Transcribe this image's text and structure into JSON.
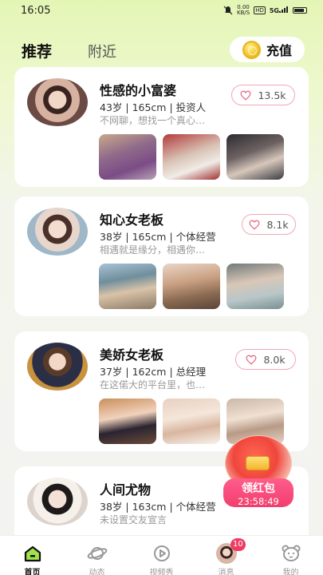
{
  "status_bar": {
    "time": "16:05",
    "network_speed": "0.00\nKB/S",
    "hd": "HD",
    "signal": "5G"
  },
  "top": {
    "tab_recommend": "推荐",
    "tab_nearby": "附近",
    "recharge_label": "充值"
  },
  "colors": {
    "accent_pink": "#f23e6f",
    "like_border": "#f2a7b5",
    "bg_green": "#e4f6b5"
  },
  "profiles": [
    {
      "name": "性感的小富婆",
      "meta": "43岁 | 165cm | 投资人",
      "bio": "不网聊，想找一个真心…",
      "likes": "13.5k"
    },
    {
      "name": "知心女老板",
      "meta": "38岁 | 165cm | 个体经营",
      "bio": "相遇就是缘分，相遇你…",
      "likes": "8.1k"
    },
    {
      "name": "美娇女老板",
      "meta": "37岁 | 162cm | 总经理",
      "bio": "在这偌大的平台里，也…",
      "likes": "8.0k"
    },
    {
      "name": "人间尤物",
      "meta": "38岁 | 163cm | 个体经营",
      "bio": "未设置交友宣言",
      "likes": ""
    }
  ],
  "red_packet": {
    "label": "领红包",
    "countdown": "23:58:49"
  },
  "nav": {
    "items": [
      {
        "label": "首页",
        "icon": "home-icon"
      },
      {
        "label": "动态",
        "icon": "planet-icon"
      },
      {
        "label": "视频秀",
        "icon": "video-play-icon"
      },
      {
        "label": "消息",
        "icon": "message-avatar"
      },
      {
        "label": "我的",
        "icon": "bear-face-icon"
      }
    ],
    "message_badge": "10"
  }
}
